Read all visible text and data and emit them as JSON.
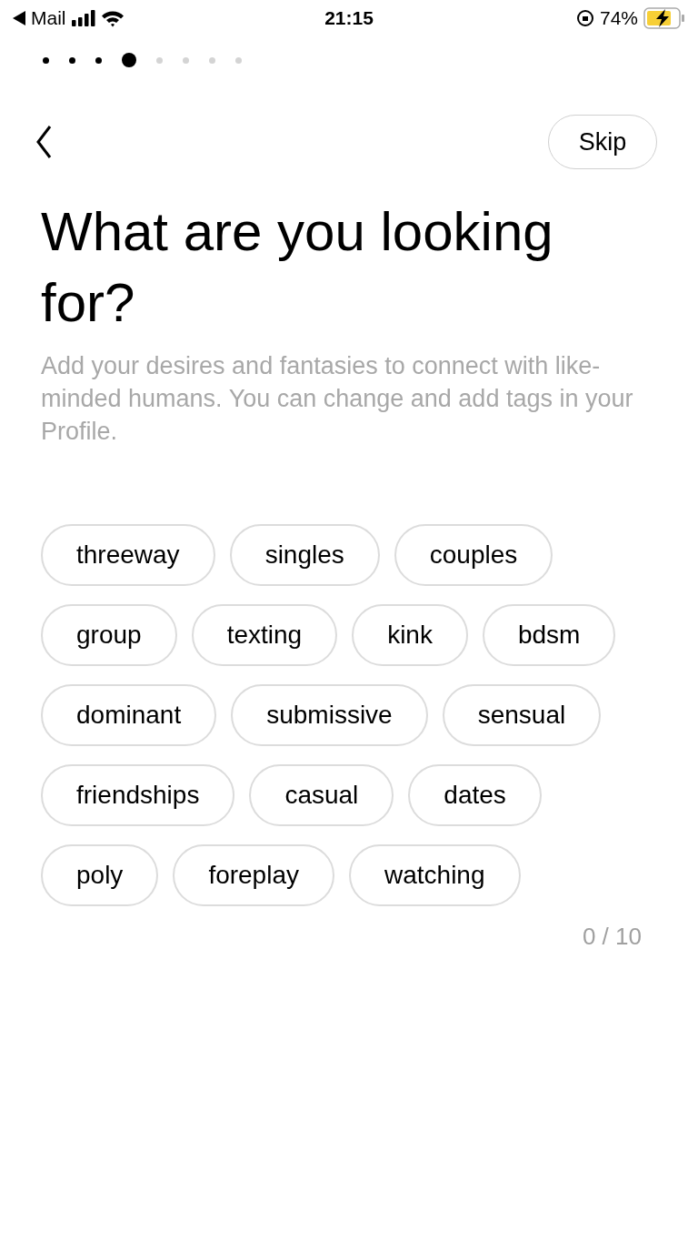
{
  "status_bar": {
    "back_app": "Mail",
    "time": "21:15",
    "battery": "74%"
  },
  "progress": [
    {
      "completed": true,
      "selected": false
    },
    {
      "completed": true,
      "selected": false
    },
    {
      "completed": true,
      "selected": false
    },
    {
      "completed": false,
      "selected": true
    },
    {
      "completed": false,
      "selected": false
    },
    {
      "completed": false,
      "selected": false
    },
    {
      "completed": false,
      "selected": false
    },
    {
      "completed": false,
      "selected": false
    }
  ],
  "skip_button": "Skip",
  "title": "What are you looking for?",
  "subtitle": "Add your desires and fantasies to connect with like-minded humans. You can change and add tags in your Profile.",
  "tags": [
    {
      "label": "threeway",
      "selected": false
    },
    {
      "label": "singles",
      "selected": false
    },
    {
      "label": "couples",
      "selected": false
    },
    {
      "label": "group",
      "selected": false
    },
    {
      "label": "texting",
      "selected": false
    },
    {
      "label": "kink",
      "selected": false
    },
    {
      "label": "bdsm",
      "selected": false
    },
    {
      "label": "dominant",
      "selected": false
    },
    {
      "label": "submissive",
      "selected": false
    },
    {
      "label": "sensual",
      "selected": false
    },
    {
      "label": "friendships",
      "selected": false
    },
    {
      "label": "casual",
      "selected": false
    },
    {
      "label": "dates",
      "selected": false
    },
    {
      "label": "poly",
      "selected": false
    },
    {
      "label": "foreplay",
      "selected": false
    },
    {
      "label": "watching",
      "selected": false
    }
  ],
  "counter": "0 / 10"
}
